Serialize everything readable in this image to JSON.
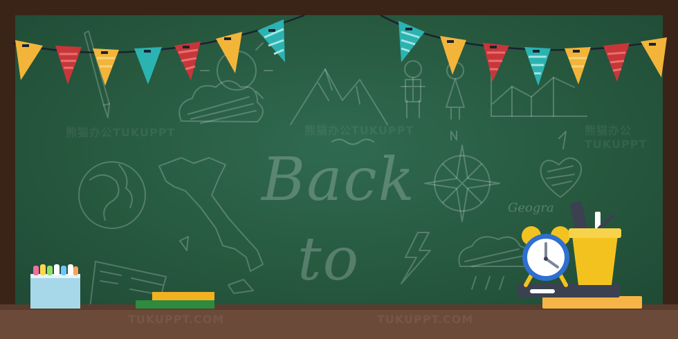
{
  "chalkboard": {
    "word_back": "Back",
    "word_to": "to",
    "geography_label": "Geogra"
  },
  "watermarks": {
    "cn": "熊猫办公TUKUPPT",
    "en": "TUKUPPT.COM"
  },
  "colors": {
    "board": "#2a5c43",
    "frame": "#3a2418",
    "ledge": "#6b4a3a",
    "flag_yellow": "#f2b53a",
    "flag_red": "#c8363a",
    "flag_teal": "#2bb3b1",
    "clock_blue": "#2f6fd0",
    "cup_yellow": "#f4c21f"
  },
  "icons": [
    "bunting-flags",
    "pencil-sketch",
    "sun-sketch",
    "cloud-sketch",
    "mountain-sketch",
    "people-sketch",
    "chart-sketch",
    "globe-sketch",
    "map-sketch",
    "compass-sketch",
    "heart-sketch",
    "lightning-sketch",
    "flag-sketch",
    "chalk-box",
    "books-stack",
    "alarm-clock",
    "pen-holder"
  ]
}
